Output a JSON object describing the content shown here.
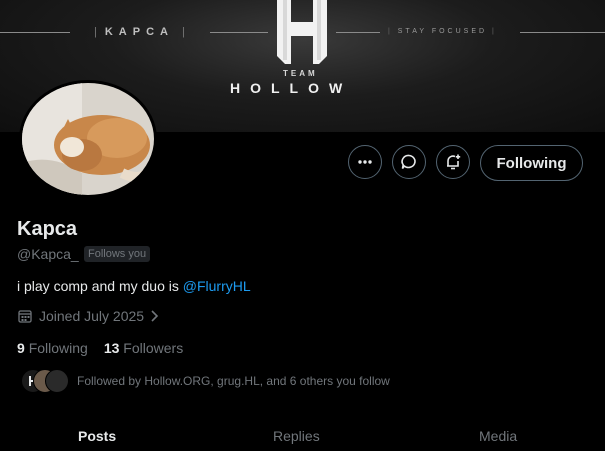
{
  "banner": {
    "left_text": "KAPCA",
    "right_text": "STAY FOCUSED",
    "team_text": "TEAM",
    "hollow_text": "HOLLOW"
  },
  "actions": {
    "more_icon": "more-horizontal-icon",
    "message_icon": "message-bubble-icon",
    "notify_icon": "bell-plus-icon",
    "follow_label": "Following"
  },
  "profile": {
    "display_name": "Kapca",
    "handle": "@Kapca_",
    "follows_you_badge": "Follows you",
    "bio_text": "i play comp and my duo is ",
    "bio_mention": "@FlurryHL",
    "joined": "Joined July 2025"
  },
  "stats": {
    "following_count": "9",
    "following_label": "Following",
    "followers_count": "13",
    "followers_label": "Followers"
  },
  "followed_by": "Followed by Hollow.ORG, grug.HL, and 6 others you follow",
  "tabs": [
    {
      "label": "Posts",
      "active": true
    },
    {
      "label": "Replies",
      "active": false
    },
    {
      "label": "Media",
      "active": false
    }
  ],
  "colors": {
    "accent": "#1d9bf0",
    "muted": "#71767b",
    "text": "#e7e9ea",
    "border": "#536471"
  }
}
